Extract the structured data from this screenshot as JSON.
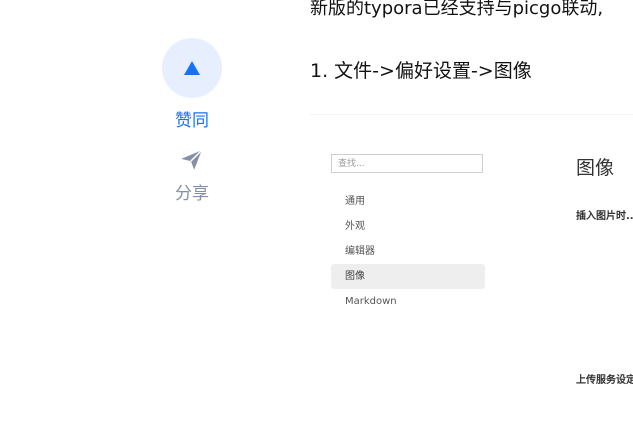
{
  "actions": {
    "vote_label": "赞同",
    "share_label": "分享"
  },
  "article": {
    "intro_line": "新版的typora已经支持与picgo联动,",
    "step1": "1. 文件->偏好设置->图像"
  },
  "screenshot": {
    "search_placeholder": "查找...",
    "menu": [
      "通用",
      "外观",
      "编辑器",
      "图像",
      "Markdown"
    ],
    "active_item": "图像",
    "pane_title": "图像",
    "insert_label": "插入图片时...",
    "upload_label": "上传服务设定"
  },
  "colors": {
    "accent": "#1772f6",
    "vote_bg": "#e7efff",
    "muted": "#8590a6"
  },
  "icons": {
    "vote": "triangle-up-icon",
    "share": "paper-plane-icon"
  }
}
